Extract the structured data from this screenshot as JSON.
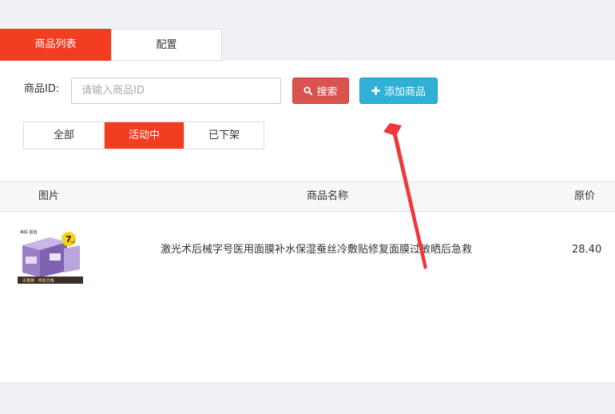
{
  "tabs": {
    "product_list": "商品列表",
    "config": "配置"
  },
  "search": {
    "label": "商品ID:",
    "placeholder": "请输入商品ID",
    "search_button": "搜索",
    "add_button": "添加商品"
  },
  "filters": {
    "all": "全部",
    "active": "活动中",
    "removed": "已下架"
  },
  "table": {
    "headers": {
      "image": "图片",
      "name": "商品名称",
      "price": "原价"
    },
    "rows": [
      {
        "name": "激光术后械字号医用面膜补水保湿蚕丝冷敷贴修复面膜过敏晒后急救",
        "price": "28.40",
        "thumb_brand": "美肤 超值",
        "thumb_badge": "7",
        "thumb_badge_unit": "片装",
        "thumb_banner": "无香精 · 修复合格"
      }
    ]
  },
  "colors": {
    "accent": "#f23d22",
    "search_button": "#d9534f",
    "add_button": "#31b0d5",
    "annotation_arrow": "#f0373b"
  }
}
